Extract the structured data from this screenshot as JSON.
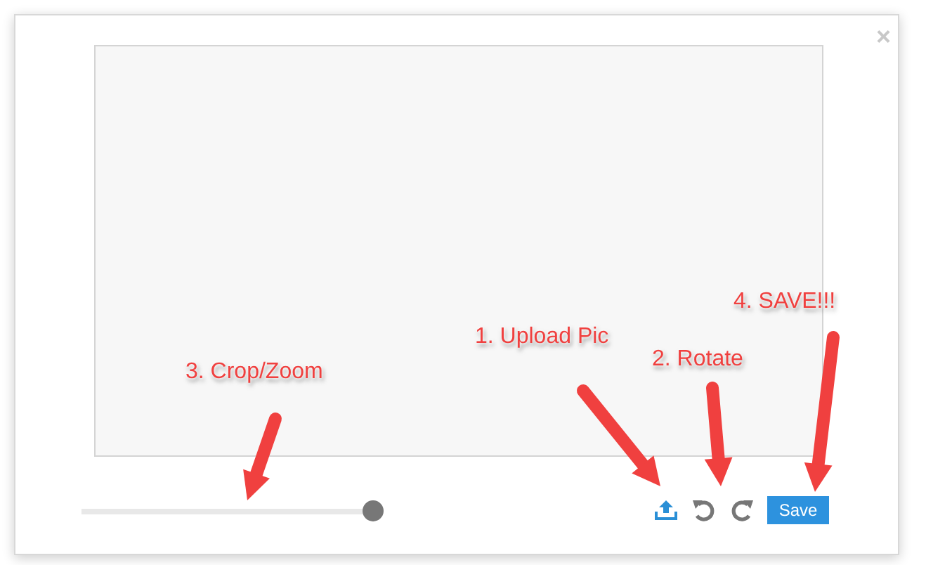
{
  "dialog": {
    "close": "×"
  },
  "zoom_slider": {
    "level": 1
  },
  "toolbar": {
    "save": "Save"
  },
  "annotations": [
    {
      "text": "1. Upload Pic"
    },
    {
      "text": "2. Rotate"
    },
    {
      "text": "3. Crop/Zoom"
    },
    {
      "text": "4. SAVE!!!"
    }
  ]
}
